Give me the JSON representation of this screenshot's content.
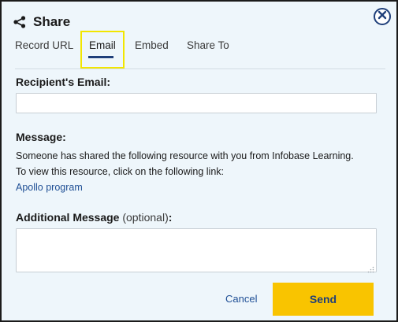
{
  "dialog": {
    "title": "Share",
    "icons": {
      "title_icon": "share-icon",
      "close": "close-icon"
    },
    "colors": {
      "accent": "#1f3f7a",
      "send_button": "#f9c400",
      "background": "#eef6fb",
      "highlight": "#f2e600"
    }
  },
  "tabs": [
    {
      "label": "Record URL",
      "active": false
    },
    {
      "label": "Email",
      "active": true
    },
    {
      "label": "Embed",
      "active": false
    },
    {
      "label": "Share To",
      "active": false
    }
  ],
  "form": {
    "recipient_label": "Recipient's Email:",
    "recipient_value": "",
    "message_label": "Message:",
    "message_line1": "Someone has shared the following resource with you from Infobase Learning.",
    "message_line2": "To view this resource, click on the following link:",
    "resource_link": "Apollo program",
    "additional_label": "Additional Message",
    "additional_optional": "(optional)",
    "additional_colon": ":",
    "additional_value": ""
  },
  "actions": {
    "cancel_label": "Cancel",
    "send_label": "Send"
  }
}
